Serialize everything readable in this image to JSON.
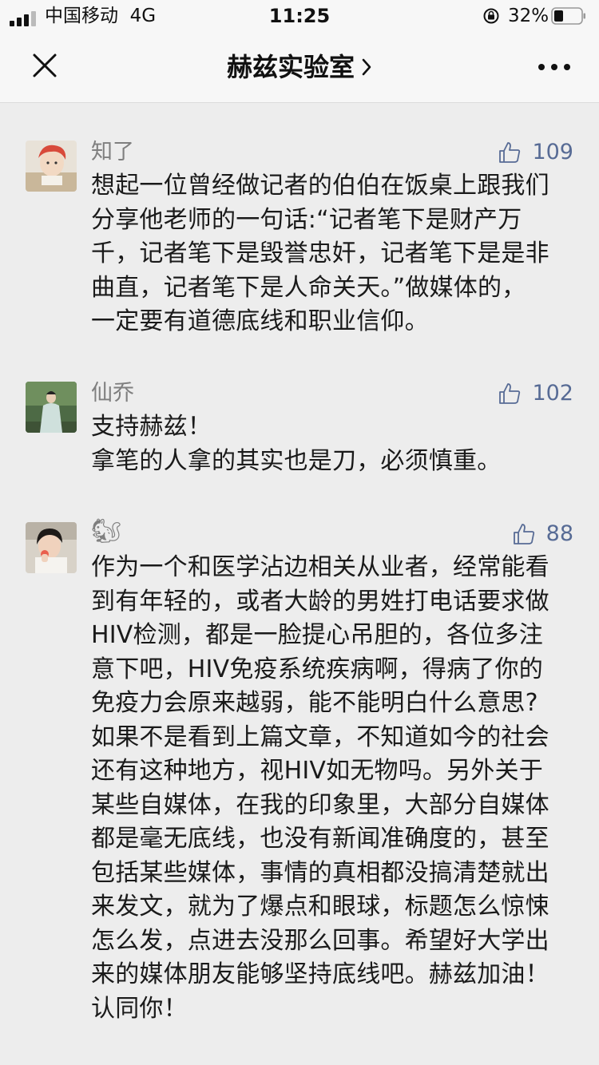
{
  "status_bar": {
    "carrier": "中国移动",
    "network": "4G",
    "time": "11:25",
    "battery_percent": "32%"
  },
  "nav": {
    "title": "赫兹实验室",
    "close_icon": "close-icon",
    "more_icon": "more-dots-icon"
  },
  "comments": [
    {
      "name": "知了",
      "likes": "109",
      "text": "想起一位曾经做记者的伯伯在饭桌上跟我们\n分享他老师的一句话:“记者笔下是财产万\n千，记者笔下是毁誉忠奸，记者笔下是是非\n曲直，记者笔下是人命关天。”做媒体的，\n一定要有道德底线和职业信仰。"
    },
    {
      "name": "仙乔",
      "likes": "102",
      "text": "支持赫兹！\n拿笔的人拿的其实也是刀，必须慎重。"
    },
    {
      "name": "🐿",
      "likes": "88",
      "text": "作为一个和医学沾边相关从业者，经常能看\n到有年轻的，或者大龄的男姓打电话要求做\nHIV检测，都是一脸提心吊胆的，各位多注\n意下吧，HIV免疫系统疾病啊，得病了你的\n免疫力会原来越弱，能不能明白什么意思?\n如果不是看到上篇文章，不知道如今的社会\n还有这种地方，视HIV如无物吗。另外关于\n某些自媒体，在我的印象里，大部分自媒体\n都是毫无底线，也没有新闻准确度的，甚至\n包括某些媒体，事情的真相都没搞清楚就出\n来发文，就为了爆点和眼球，标题怎么惊悚\n怎么发，点进去没那么回事。希望好大学出\n来的媒体朋友能够坚持底线吧。赫兹加油！\n认同你！"
    }
  ],
  "colors": {
    "like_count": "#576b95",
    "nickname": "#7f7f7f",
    "background": "#ededed"
  }
}
